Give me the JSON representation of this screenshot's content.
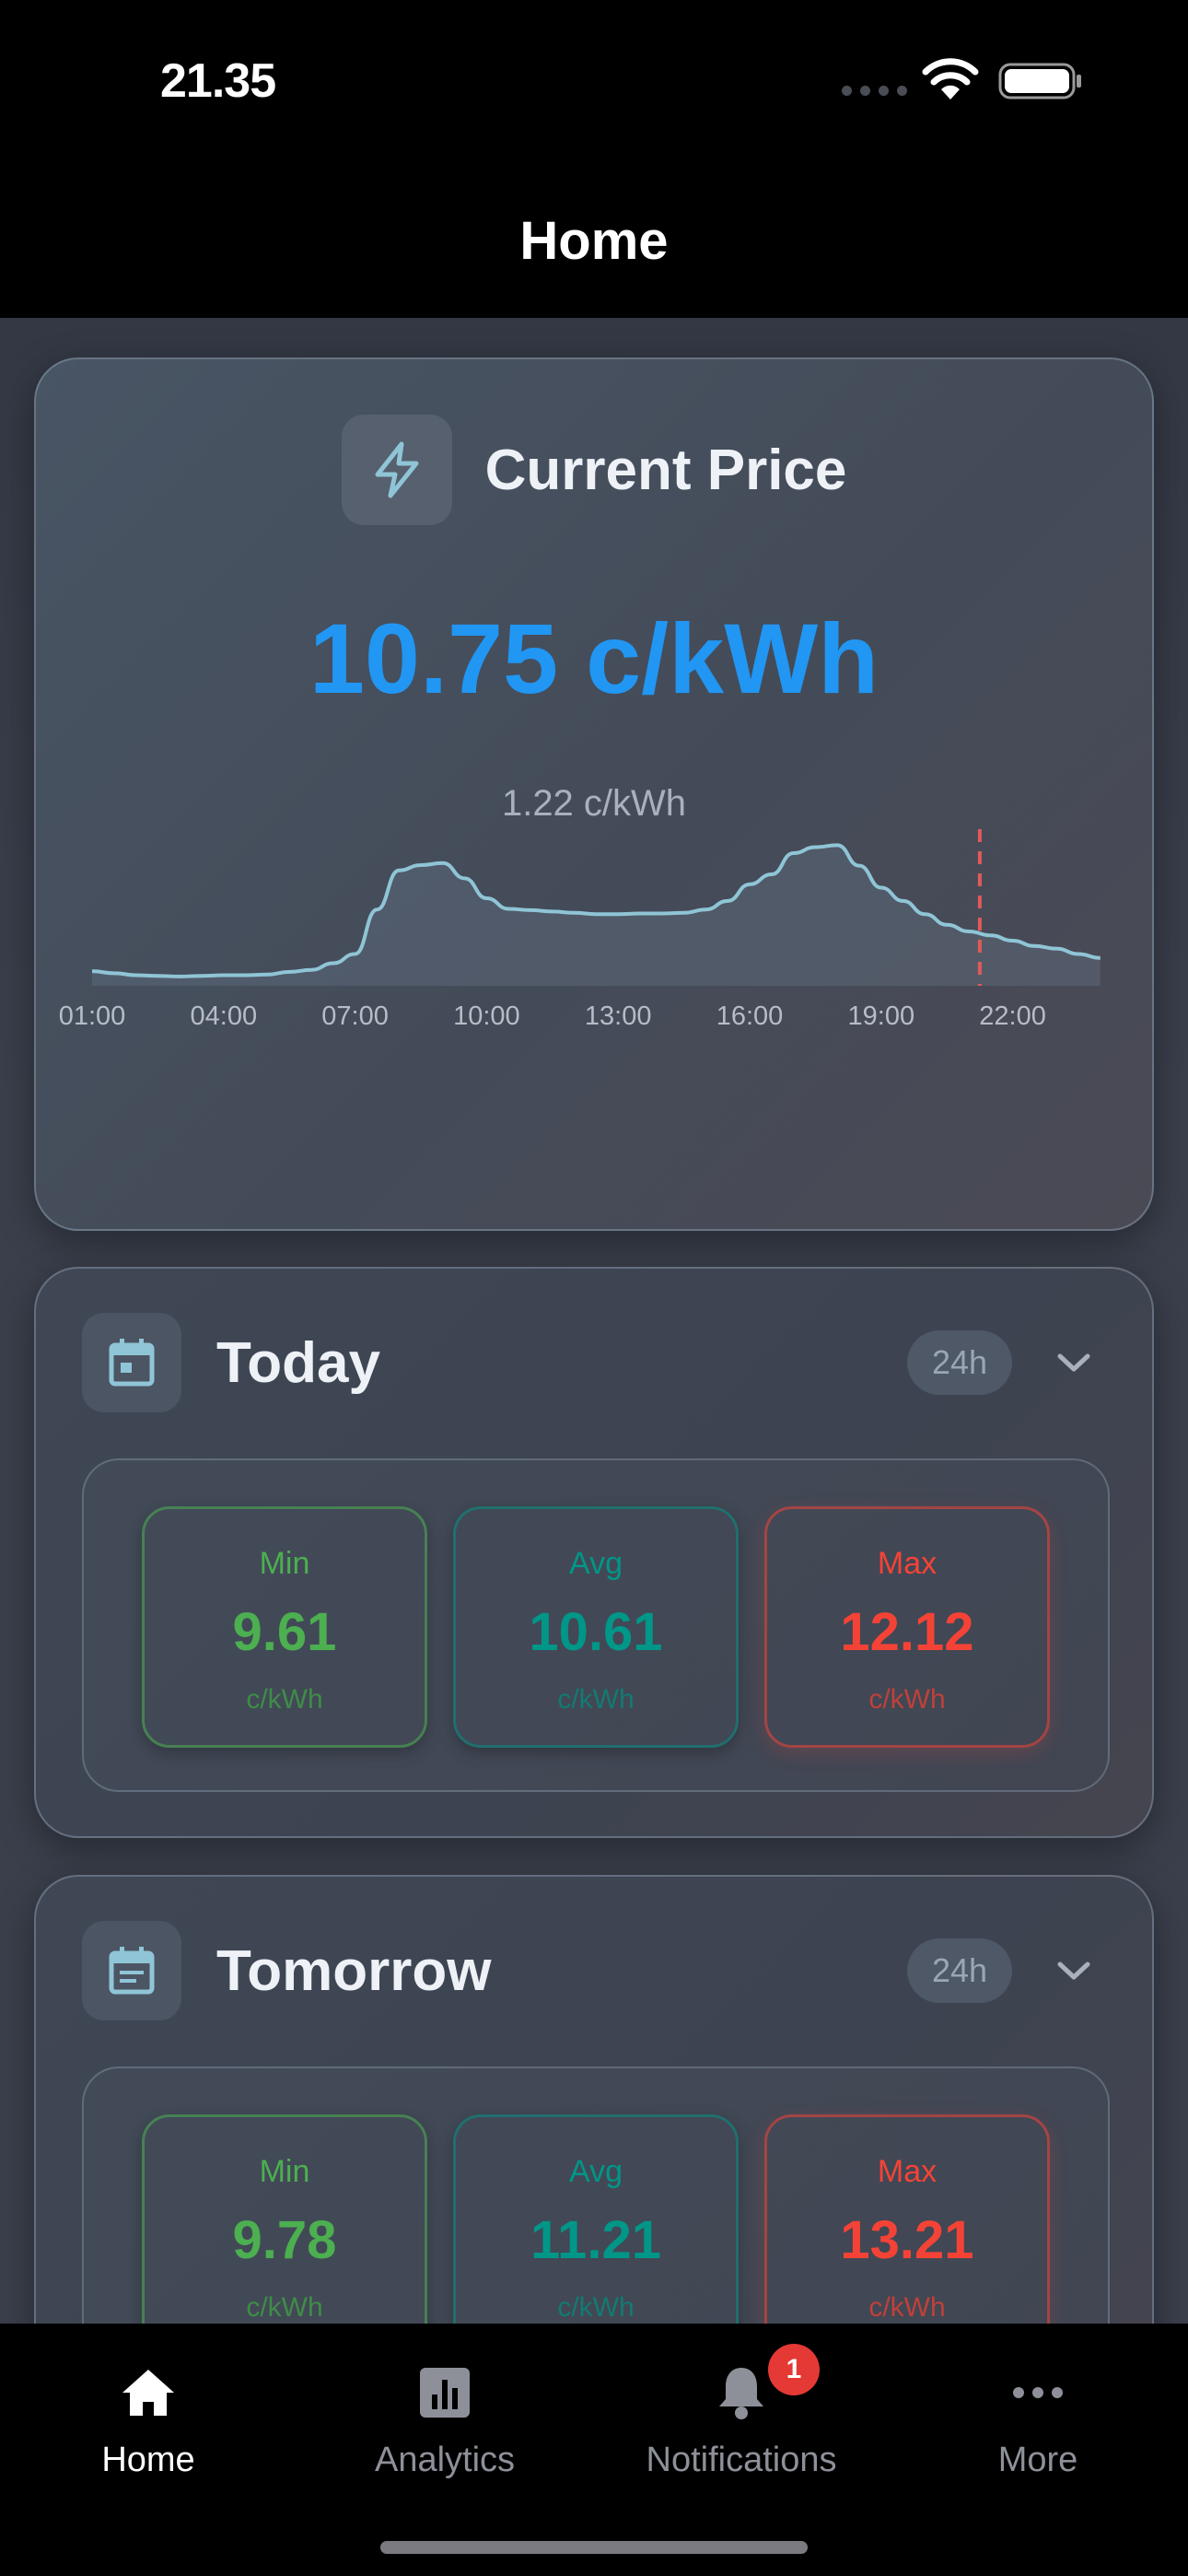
{
  "status_bar": {
    "time": "21.35"
  },
  "header": {
    "title": "Home"
  },
  "current_price": {
    "title": "Current Price",
    "price": "10.75 c/kWh",
    "secondary": "1.22 c/kWh",
    "icon": "lightning-bolt-icon",
    "accent_color": "#2196f3",
    "chart_data": {
      "type": "area",
      "x_ticks": [
        "01:00",
        "04:00",
        "07:00",
        "10:00",
        "13:00",
        "16:00",
        "19:00",
        "22:00"
      ],
      "x_hours": [
        1,
        1.5,
        2,
        2.5,
        3,
        3.5,
        4,
        4.5,
        5,
        5.5,
        6,
        6.5,
        7,
        7.5,
        8,
        8.5,
        9,
        9.5,
        10,
        10.5,
        11,
        11.5,
        12,
        12.5,
        13,
        13.5,
        14,
        14.5,
        15,
        15.5,
        16,
        16.5,
        17,
        17.5,
        18,
        18.5,
        19,
        19.5,
        20,
        20.5,
        21,
        21.5,
        22,
        22.5,
        23,
        23.5,
        24
      ],
      "values": [
        9.72,
        9.69,
        9.66,
        9.65,
        9.64,
        9.65,
        9.66,
        9.66,
        9.67,
        9.71,
        9.74,
        9.84,
        9.98,
        10.65,
        11.24,
        11.32,
        11.35,
        11.12,
        10.82,
        10.66,
        10.64,
        10.62,
        10.6,
        10.58,
        10.58,
        10.59,
        10.59,
        10.6,
        10.65,
        10.78,
        11.03,
        11.18,
        11.5,
        11.59,
        11.62,
        11.31,
        10.98,
        10.78,
        10.58,
        10.42,
        10.32,
        10.26,
        10.18,
        10.1,
        10.06,
        9.98,
        9.92
      ],
      "ylim": [
        9.5,
        12.0
      ],
      "current_time_marker": "21:15",
      "line_color": "#8fc5d6",
      "marker_color": "#e05a5a"
    }
  },
  "today": {
    "title": "Today",
    "badge": "24h",
    "icon": "calendar-icon",
    "min": {
      "label": "Min",
      "value": "9.61",
      "unit": "c/kWh"
    },
    "avg": {
      "label": "Avg",
      "value": "10.61",
      "unit": "c/kWh"
    },
    "max": {
      "label": "Max",
      "value": "12.12",
      "unit": "c/kWh"
    }
  },
  "tomorrow": {
    "title": "Tomorrow",
    "badge": "24h",
    "icon": "calendar-icon",
    "min": {
      "label": "Min",
      "value": "9.78",
      "unit": "c/kWh"
    },
    "avg": {
      "label": "Avg",
      "value": "11.21",
      "unit": "c/kWh"
    },
    "max": {
      "label": "Max",
      "value": "13.21",
      "unit": "c/kWh"
    }
  },
  "tabs": [
    {
      "label": "Home",
      "icon": "house-icon",
      "active": true
    },
    {
      "label": "Analytics",
      "icon": "bar-chart-icon",
      "active": false
    },
    {
      "label": "Notifications",
      "icon": "bell-icon",
      "active": false,
      "badge": "1"
    },
    {
      "label": "More",
      "icon": "ellipsis-icon",
      "active": false
    }
  ]
}
